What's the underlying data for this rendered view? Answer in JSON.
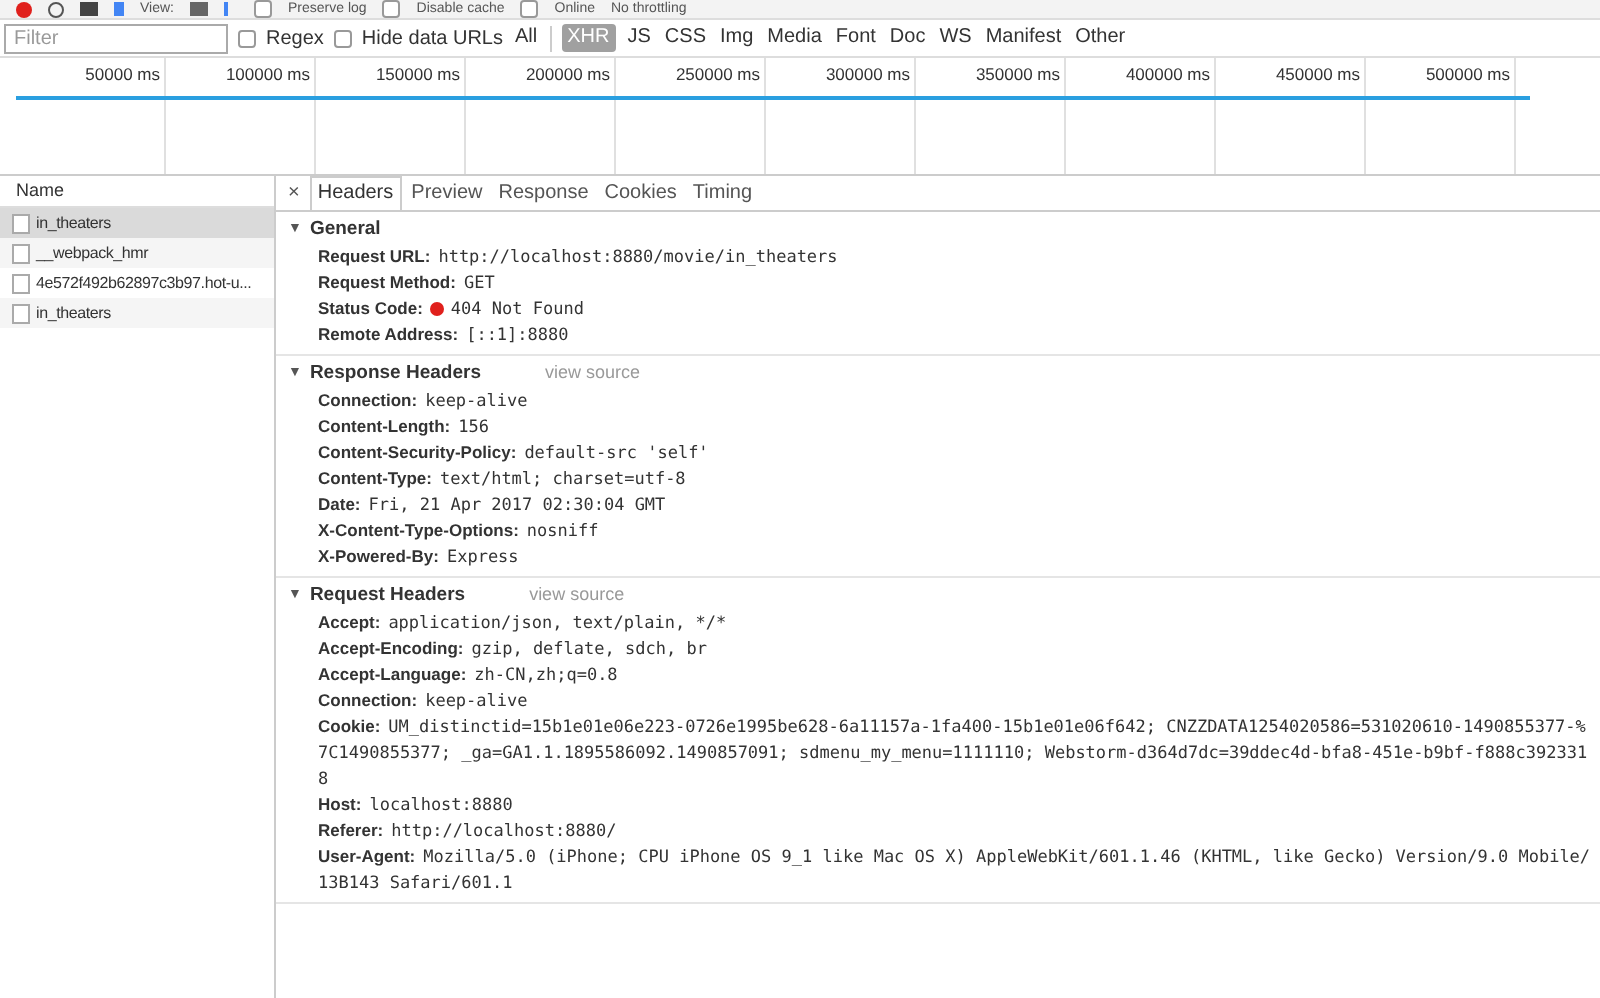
{
  "top_toolbar": {
    "view_label": "View:",
    "checkboxes": [
      {
        "label": "Preserve log",
        "checked": false
      },
      {
        "label": "Disable cache",
        "checked": false
      },
      {
        "label": "Online",
        "checked": false
      }
    ],
    "throttling": "No throttling"
  },
  "filter_bar": {
    "placeholder": "Filter",
    "checkboxes": [
      {
        "label": "Regex",
        "checked": false
      },
      {
        "label": "Hide data URLs",
        "checked": false
      }
    ],
    "types": [
      {
        "label": "All",
        "selected": false
      },
      {
        "label": "XHR",
        "selected": true
      },
      {
        "label": "JS",
        "selected": false
      },
      {
        "label": "CSS",
        "selected": false
      },
      {
        "label": "Img",
        "selected": false
      },
      {
        "label": "Media",
        "selected": false
      },
      {
        "label": "Font",
        "selected": false
      },
      {
        "label": "Doc",
        "selected": false
      },
      {
        "label": "WS",
        "selected": false
      },
      {
        "label": "Manifest",
        "selected": false
      },
      {
        "label": "Other",
        "selected": false
      }
    ]
  },
  "timeline": {
    "ticks": [
      "50000 ms",
      "100000 ms",
      "150000 ms",
      "200000 ms",
      "250000 ms",
      "300000 ms",
      "350000 ms",
      "400000 ms",
      "450000 ms",
      "500000 ms"
    ]
  },
  "requests": {
    "column": "Name",
    "rows": [
      {
        "name": "in_theaters",
        "selected": true
      },
      {
        "name": "__webpack_hmr",
        "selected": false
      },
      {
        "name": "4e572f492b62897c3b97.hot-u...",
        "selected": false
      },
      {
        "name": "in_theaters",
        "selected": false
      }
    ]
  },
  "details": {
    "close": "×",
    "tabs": [
      {
        "label": "Headers",
        "selected": true
      },
      {
        "label": "Preview",
        "selected": false
      },
      {
        "label": "Response",
        "selected": false
      },
      {
        "label": "Cookies",
        "selected": false
      },
      {
        "label": "Timing",
        "selected": false
      }
    ],
    "sections": [
      {
        "toggle": "▼",
        "title": "General",
        "rows": [
          {
            "key": "Request URL:",
            "value": "http://localhost:8880/movie/in_theaters"
          },
          {
            "key": "Request Method:",
            "value": "GET"
          },
          {
            "key": "Status Code:",
            "value": "404 Not Found",
            "color": "#e0201c"
          },
          {
            "key": "Remote Address:",
            "value": "[::1]:8880"
          }
        ]
      },
      {
        "toggle": "▼",
        "title": "Response Headers",
        "link": "view source",
        "rows": [
          {
            "key": "Connection:",
            "value": "keep-alive"
          },
          {
            "key": "Content-Length:",
            "value": "156"
          },
          {
            "key": "Content-Security-Policy:",
            "value": "default-src 'self'"
          },
          {
            "key": "Content-Type:",
            "value": "text/html; charset=utf-8"
          },
          {
            "key": "Date:",
            "value": "Fri, 21 Apr 2017 02:30:04 GMT"
          },
          {
            "key": "X-Content-Type-Options:",
            "value": "nosniff"
          },
          {
            "key": "X-Powered-By:",
            "value": "Express"
          }
        ]
      },
      {
        "toggle": "▼",
        "title": "Request Headers",
        "link": "view source",
        "rows": [
          {
            "key": "Accept:",
            "value": "application/json, text/plain, */*"
          },
          {
            "key": "Accept-Encoding:",
            "value": "gzip, deflate, sdch, br"
          },
          {
            "key": "Accept-Language:",
            "value": "zh-CN,zh;q=0.8"
          },
          {
            "key": "Connection:",
            "value": "keep-alive"
          },
          {
            "key": "Cookie:",
            "value": "UM_distinctid=15b1e01e06e223-0726e1995be628-6a11157a-1fa400-15b1e01e06f642; CNZZDATA1254020586=531020610-1490855377-%7C1490855377; _ga=GA1.1.1895586092.1490857091; sdmenu_my_menu=1111110; Webstorm-d364d7dc=39ddec4d-bfa8-451e-b9bf-f888c3923318"
          },
          {
            "key": "Host:",
            "value": "localhost:8880"
          },
          {
            "key": "Referer:",
            "value": "http://localhost:8880/"
          },
          {
            "key": "User-Agent:",
            "value": "Mozilla/5.0 (iPhone; CPU iPhone OS 9_1 like Mac OS X) AppleWebKit/601.1.46 (KHTML, like Gecko) Version/9.0 Mobile/13B143 Safari/601.1"
          }
        ]
      }
    ]
  }
}
